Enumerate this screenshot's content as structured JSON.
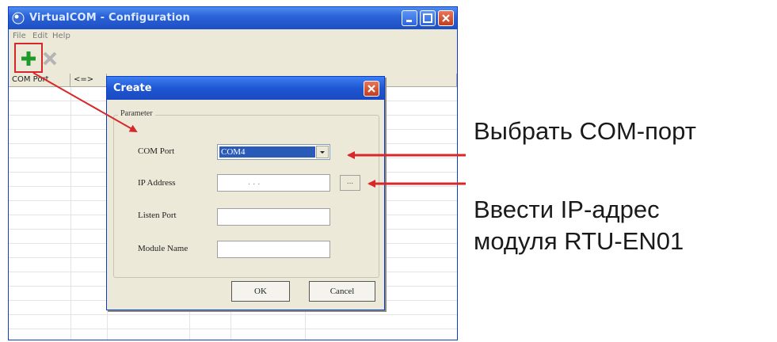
{
  "window": {
    "title": "VirtualCOM - Configuration",
    "menu": [
      "File",
      "Edit",
      "Help"
    ],
    "columns": [
      "COM Port",
      "<=>"
    ],
    "accent_color": "#2b63d8",
    "add_icon": "plus-icon",
    "delete_icon": "x-icon"
  },
  "dialog": {
    "title": "Create",
    "group_label": "Parameter",
    "com_port_label": "COM Port",
    "com_port_value": "COM4",
    "ip_label": "IP Address",
    "ip_value": ". . .",
    "browse_label": "...",
    "listen_port_label": "Listen Port",
    "listen_port_value": "",
    "module_name_label": "Module Name",
    "module_name_value": "",
    "ok_label": "OK",
    "cancel_label": "Cancel"
  },
  "annotations": {
    "select_com": "Выбрать COM-порт",
    "enter_ip_line1": "Ввести IP-адрес",
    "enter_ip_line2": "модуля RTU-EN01",
    "arrow_color": "#d8272a"
  }
}
